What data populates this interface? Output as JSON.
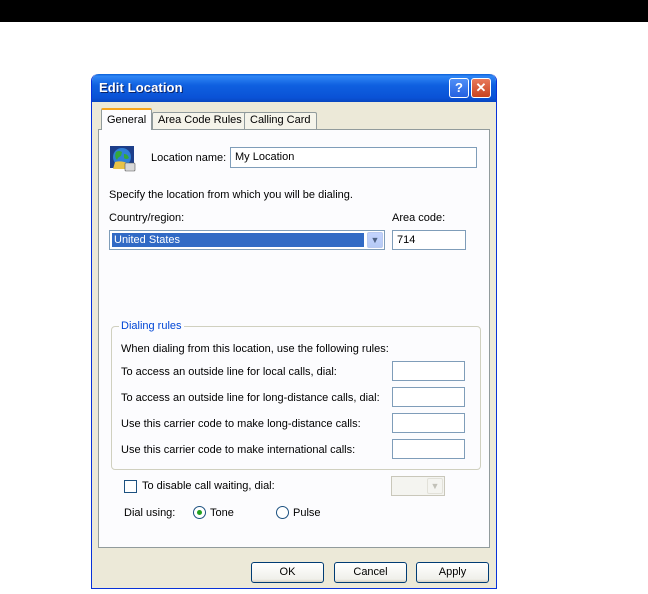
{
  "window": {
    "title": "Edit Location",
    "help_button": "?",
    "close_button": "✕"
  },
  "tabs": [
    {
      "label": "General",
      "active": true
    },
    {
      "label": "Area Code Rules",
      "active": false
    },
    {
      "label": "Calling Card",
      "active": false
    }
  ],
  "general": {
    "location_name_label": "Location name:",
    "location_name_value": "My Location",
    "specify_text": "Specify the location from which you will be dialing.",
    "country_label": "Country/region:",
    "country_value": "United States",
    "area_code_label": "Area code:",
    "area_code_value": "714"
  },
  "dialing_rules": {
    "legend": "Dialing rules",
    "intro": "When dialing from this location, use the following rules:",
    "rows": [
      {
        "label": "To access an outside line for local calls, dial:",
        "value": ""
      },
      {
        "label": "To access an outside line for long-distance calls, dial:",
        "value": ""
      },
      {
        "label": "Use this carrier code to make long-distance calls:",
        "value": ""
      },
      {
        "label": "Use this carrier code to make international calls:",
        "value": ""
      }
    ]
  },
  "call_waiting": {
    "label": "To disable call waiting, dial:",
    "checked": false,
    "value": ""
  },
  "dial_using": {
    "label": "Dial using:",
    "options": [
      {
        "label": "Tone",
        "selected": true
      },
      {
        "label": "Pulse",
        "selected": false
      }
    ]
  },
  "buttons": {
    "ok": "OK",
    "cancel": "Cancel",
    "apply": "Apply"
  },
  "icons": {
    "location": "globe-phone-icon",
    "dropdown": "chevron-down-icon"
  }
}
